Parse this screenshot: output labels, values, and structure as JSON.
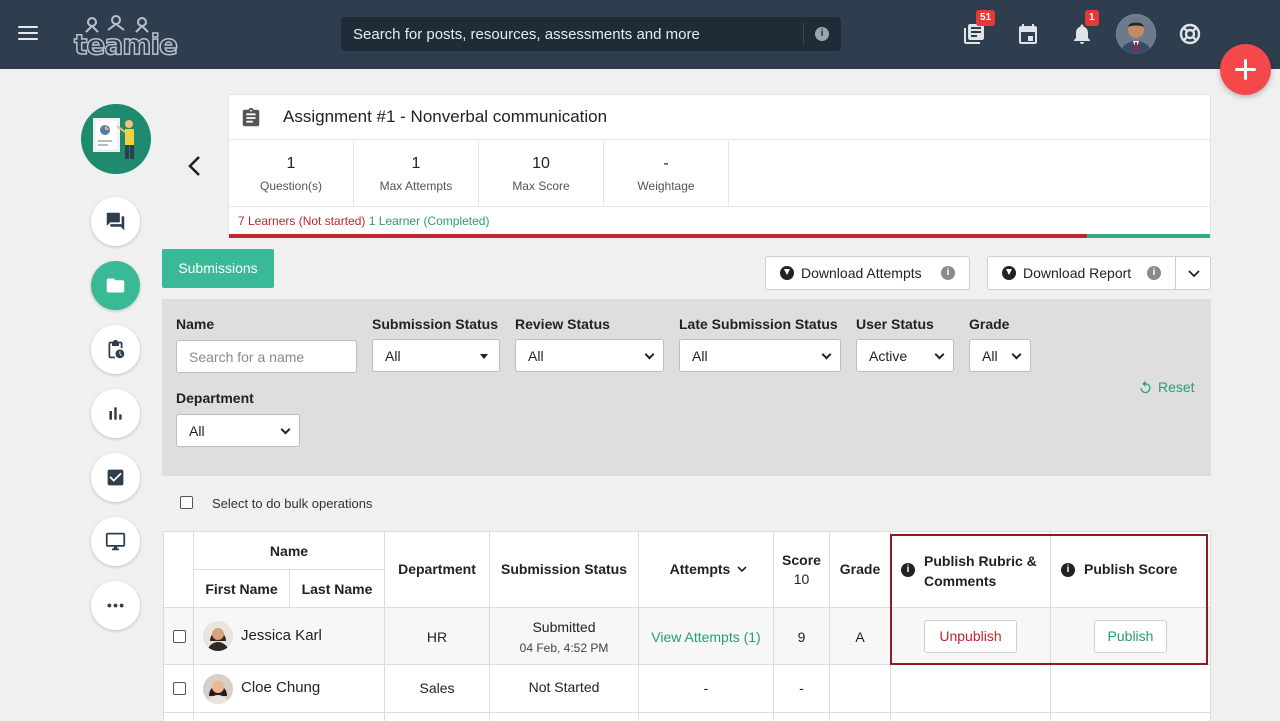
{
  "topbar": {
    "logo": "teamie",
    "search_placeholder": "Search for posts, resources, assessments and more",
    "search_info": "i",
    "newsfeed_badge": "51",
    "notifications_badge": "1"
  },
  "assignment": {
    "title": "Assignment #1 - Nonverbal communication",
    "stats": [
      {
        "value": "1",
        "label": "Question(s)"
      },
      {
        "value": "1",
        "label": "Max Attempts"
      },
      {
        "value": "10",
        "label": "Max Score"
      },
      {
        "value": "-",
        "label": "Weightage"
      }
    ],
    "learners_not_started": "7 Learners (Not started)",
    "learners_completed": "1 Learner (Completed)",
    "completed_fraction": 0.125
  },
  "toolbar": {
    "submissions": "Submissions",
    "download_attempts": "Download Attempts",
    "download_report": "Download Report",
    "info": "i"
  },
  "filters": {
    "name_label": "Name",
    "name_placeholder": "Search for a name",
    "submission_status_label": "Submission Status",
    "submission_status_value": "All",
    "review_status_label": "Review Status",
    "review_status_value": "All",
    "late_submission_label": "Late Submission Status",
    "late_submission_value": "All",
    "user_status_label": "User Status",
    "user_status_value": "Active",
    "grade_label": "Grade",
    "grade_value": "All",
    "department_label": "Department",
    "department_value": "All",
    "reset": "Reset"
  },
  "bulk": "Select to do bulk operations",
  "table": {
    "name": "Name",
    "first_name": "First Name",
    "last_name": "Last Name",
    "department": "Department",
    "submission_status": "Submission Status",
    "attempts": "Attempts",
    "score": "Score",
    "score_max": "10",
    "grade": "Grade",
    "publish_rubric": "Publish Rubric & Comments",
    "publish_score": "Publish Score",
    "rows": [
      {
        "name": "Jessica Karl",
        "department": "HR",
        "status": "Submitted",
        "status_time": "04 Feb, 4:52 PM",
        "attempts": "View Attempts (1)",
        "score": "9",
        "grade": "A",
        "rubric_action": "Unpublish",
        "score_action": "Publish"
      },
      {
        "name": "Cloe Chung",
        "department": "Sales",
        "status": "Not Started",
        "attempts": "-",
        "score": "-",
        "grade": ""
      }
    ]
  },
  "colors": {
    "topbar": "#2e3e4f",
    "accent_green": "#3ab996",
    "danger_red": "#c0262d",
    "fab": "#f4484b"
  }
}
